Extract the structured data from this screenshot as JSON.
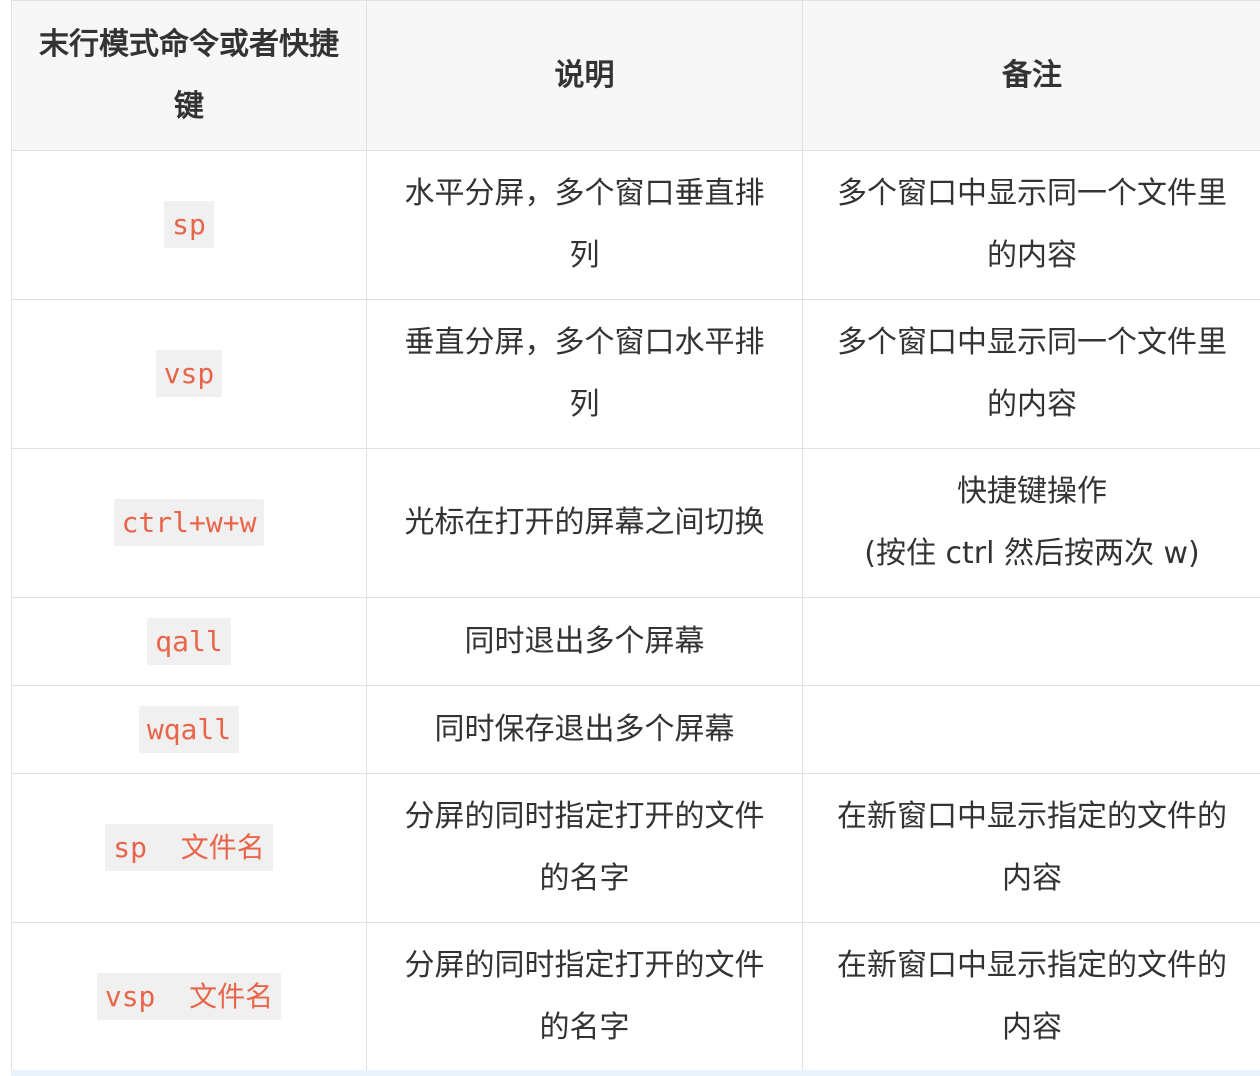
{
  "table": {
    "headers": [
      "末行模式命令或者快捷键",
      "说明",
      "备注"
    ],
    "rows": [
      {
        "command": "sp",
        "description": "水平分屏，多个窗口垂直排列",
        "note": "多个窗口中显示同一个文件里的内容"
      },
      {
        "command": "vsp",
        "description": "垂直分屏，多个窗口水平排列",
        "note": "多个窗口中显示同一个文件里的内容"
      },
      {
        "command": "ctrl+w+w",
        "description": "光标在打开的屏幕之间切换",
        "note_line1": "快捷键操作",
        "note_line2": "(按住 ctrl 然后按两次 w)"
      },
      {
        "command": "qall",
        "description": "同时退出多个屏幕",
        "note": ""
      },
      {
        "command": "wqall",
        "description": "同时保存退出多个屏幕",
        "note": ""
      },
      {
        "command": "sp  文件名",
        "description": "分屏的同时指定打开的文件的名字",
        "note": "在新窗口中显示指定的文件的内容"
      },
      {
        "command": "vsp  文件名",
        "description": "分屏的同时指定打开的文件的名字",
        "note": "在新窗口中显示指定的文件的内容"
      }
    ]
  }
}
